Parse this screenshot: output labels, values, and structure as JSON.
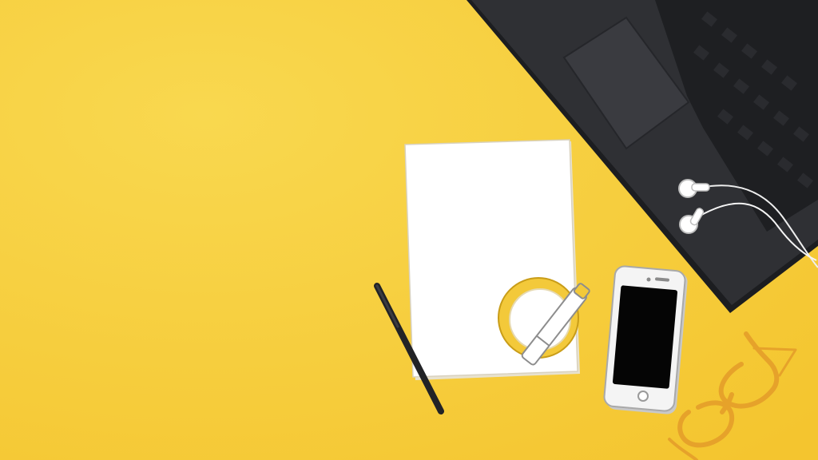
{
  "scene": {
    "description_free": true,
    "colors": {
      "background": "#f6cc3b",
      "background_light": "#f9d84f",
      "laptop_body": "#2f3034",
      "laptop_edge": "#1c1d20",
      "keys": "#1e1f22",
      "trackpad": "#3a3b40",
      "paper": "#ffffff",
      "tape": "#f3c93a",
      "pen": "#222326",
      "phone_body": "#f4f4f4",
      "phone_screen": "#050505",
      "glasses": "#e6a22a",
      "earphone": "#f5f5f5"
    },
    "icons": [
      "laptop-icon",
      "paper-sheet-icon",
      "tape-roll-icon",
      "pen-icon",
      "phone-icon",
      "earphones-icon",
      "eyeglasses-icon"
    ]
  }
}
